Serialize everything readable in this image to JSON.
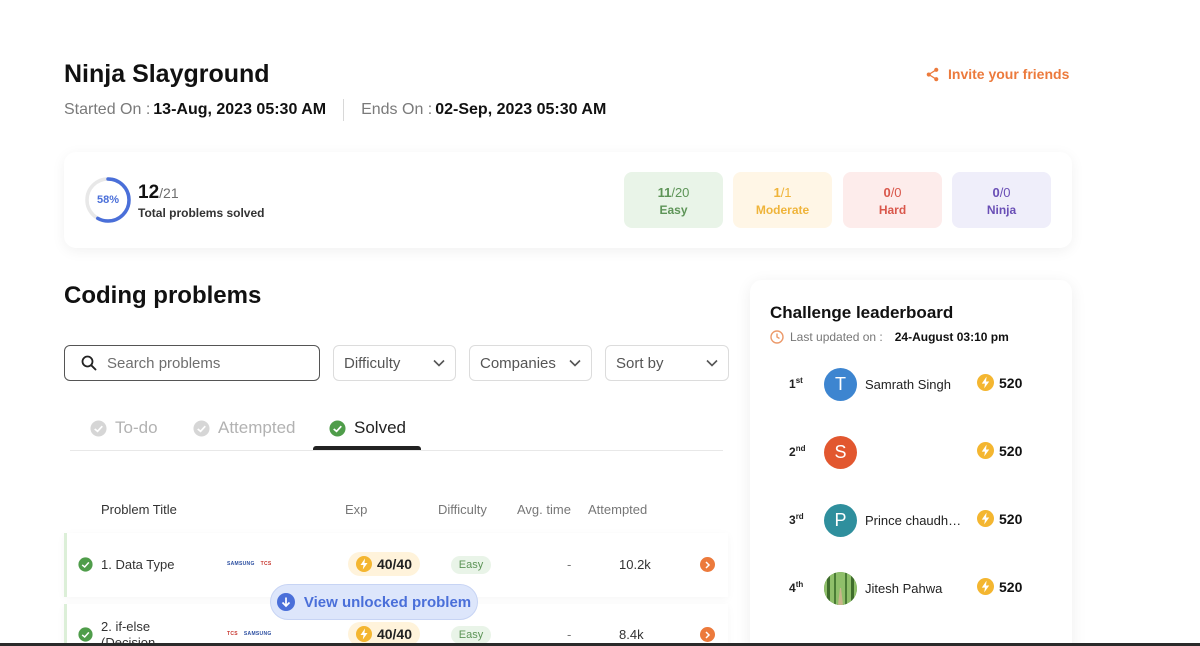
{
  "header": {
    "title": "Ninja Slayground",
    "started_label": "Started On :",
    "started_value": "13-Aug, 2023 05:30 AM",
    "ends_label": "Ends On :",
    "ends_value": "02-Sep, 2023 05:30 AM",
    "invite_label": "Invite your friends"
  },
  "stats": {
    "percent": "58%",
    "percent_value": 58,
    "solved": "12",
    "total": "/21",
    "label": "Total problems solved",
    "difficulties": [
      {
        "solved": "11",
        "total": "/20",
        "label": "Easy",
        "bg": "#e9f4e8",
        "color": "#5d9457"
      },
      {
        "solved": "1",
        "total": "/1",
        "label": "Moderate",
        "bg": "#fff6e6",
        "color": "#efb43a"
      },
      {
        "solved": "0",
        "total": "/0",
        "label": "Hard",
        "bg": "#fdeceb",
        "color": "#d9574b"
      },
      {
        "solved": "0",
        "total": "/0",
        "label": "Ninja",
        "bg": "#efeefa",
        "color": "#6a4fb6"
      }
    ]
  },
  "problems": {
    "title": "Coding problems",
    "search_placeholder": "Search problems",
    "filters": [
      "Difficulty",
      "Companies",
      "Sort by"
    ],
    "tabs": [
      "To-do",
      "Attempted",
      "Solved"
    ],
    "columns": [
      "Problem Title",
      "Exp",
      "Difficulty",
      "Avg. time",
      "Attempted"
    ],
    "rows": [
      {
        "title": "1. Data Type",
        "title2": "",
        "logos": [
          "SAMSUNG",
          "TCS"
        ],
        "exp": "40/40",
        "difficulty": "Easy",
        "avg_time": "-",
        "attempted": "10.2k"
      },
      {
        "title": "2. if-else",
        "title2": "(Decision",
        "logos": [
          "TCS",
          "SAMSUNG"
        ],
        "exp": "40/40",
        "difficulty": "Easy",
        "avg_time": "-",
        "attempted": "8.4k"
      }
    ],
    "unlock_label": "View unlocked problem"
  },
  "leaderboard": {
    "title": "Challenge leaderboard",
    "updated_label": "Last updated on :",
    "updated_value": "24-August 03:10 pm",
    "entries": [
      {
        "rank": "1",
        "suffix": "st",
        "initial": "T",
        "name": "Samrath Singh",
        "score": "520",
        "color": "#3d85d0"
      },
      {
        "rank": "2",
        "suffix": "nd",
        "initial": "S",
        "name": "",
        "score": "520",
        "color": "#e2572f"
      },
      {
        "rank": "3",
        "suffix": "rd",
        "initial": "P",
        "name": "Prince chaudhary",
        "score": "520",
        "color": "#2f8f9d"
      },
      {
        "rank": "4",
        "suffix": "th",
        "initial": "",
        "name": "Jitesh Pahwa",
        "score": "520",
        "color": "#5a8a4a"
      }
    ]
  }
}
